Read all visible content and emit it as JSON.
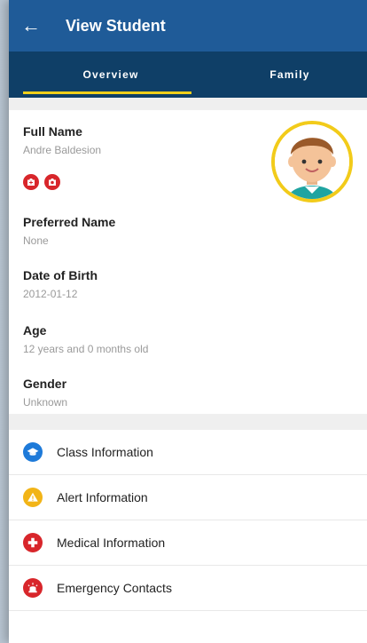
{
  "header": {
    "title": "View Student",
    "back_icon": "arrow-left-icon"
  },
  "tabs": [
    {
      "label": "Overview",
      "active": true
    },
    {
      "label": "Family",
      "active": false
    }
  ],
  "student": {
    "full_name_label": "Full Name",
    "full_name": "Andre Baldesion",
    "preferred_name_label": "Preferred Name",
    "preferred_name": "None",
    "dob_label": "Date of Birth",
    "dob": "2012-01-12",
    "age_label": "Age",
    "age": "12 years and 0 months old",
    "gender_label": "Gender",
    "gender": "Unknown"
  },
  "menu": [
    {
      "label": "Class Information",
      "icon": "graduation-cap-icon",
      "color": "#1e7ad9"
    },
    {
      "label": "Alert Information",
      "icon": "warning-icon",
      "color": "#f2b417"
    },
    {
      "label": "Medical Information",
      "icon": "medical-cross-icon",
      "color": "#d8262b"
    },
    {
      "label": "Emergency Contacts",
      "icon": "siren-icon",
      "color": "#d8262b"
    }
  ],
  "colors": {
    "appbar": "#1f5b98",
    "tabbar": "#0f3f67",
    "accent": "#f0cf1a",
    "danger": "#d8262b"
  }
}
